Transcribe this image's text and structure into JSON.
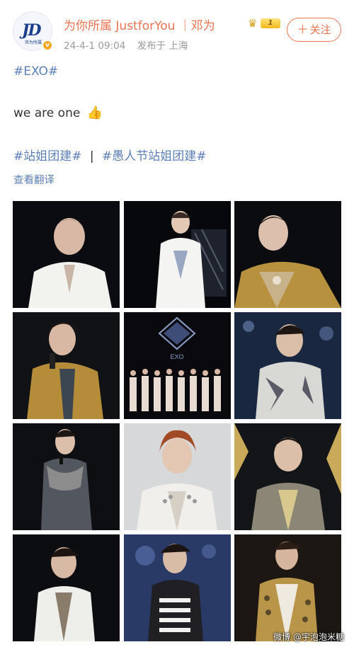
{
  "post": {
    "username": "为你所属 JustforYou ｜邓为",
    "level_badge": "1",
    "date": "24-4-1 09:04",
    "location": "发布于 上海",
    "follow_label": "关注",
    "follow_plus": "＋",
    "avatar_logo": "JD",
    "avatar_sub": "邓为所属",
    "verified_mark": "v",
    "hashtag": "#EXO#",
    "text": "we are one",
    "tag1": "#站姐团建#",
    "tag_separator": "|",
    "tag2": "#愚人节站姐团建#",
    "translate_label": "查看翻译"
  },
  "icons": {
    "crown": "crown-icon",
    "thumb": "thumbs-up-icon",
    "verified": "verified-badge-icon"
  },
  "images": {
    "count": 12,
    "group_logo_text": "EXO"
  },
  "watermark": "微博 @宇泡泡米糖",
  "colors": {
    "brand_orange": "#eb7350",
    "link_blue": "#5b7fb8",
    "meta_gray": "#999999"
  }
}
